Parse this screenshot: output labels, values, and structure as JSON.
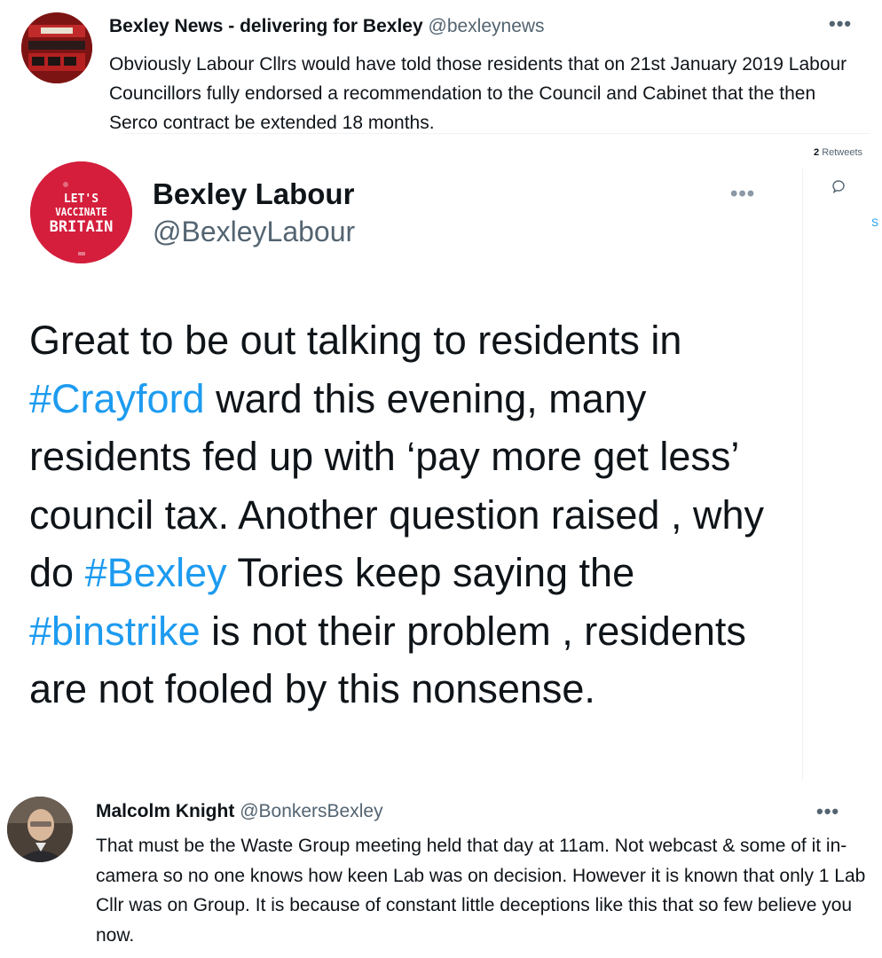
{
  "tweet1": {
    "name": "Bexley News - delivering for Bexley",
    "handle": "@bexleynews",
    "more": "•••",
    "text": "Obviously Labour Cllrs would have told those residents that on 21st January 2019 Labour Councillors fully endorsed a recommendation to the Council and Cabinet that the then Serco contract be extended 18 months."
  },
  "side": {
    "retweet_count": "2",
    "retweet_label": "Retweets",
    "reply_icon": "reply-bubble-icon",
    "letter": "S"
  },
  "tweet2": {
    "avatar_text": [
      "LET'S",
      "VACCINATE",
      "BRITAIN"
    ],
    "name": "Bexley Labour",
    "handle": "@BexleyLabour",
    "more": "•••",
    "text_parts": [
      "Great to be out talking to residents in ",
      "#Crayford",
      " ward this evening, many residents fed up with ‘pay more get less’ council tax. Another question raised , why do ",
      "#Bexley",
      " Tories keep saying the ",
      "#binstrike",
      " is not their problem , residents are not fooled by this nonsense."
    ]
  },
  "tweet3": {
    "name": "Malcolm Knight",
    "handle": "@BonkersBexley",
    "more": "•••",
    "text": "That must be the Waste Group meeting held that day at 11am. Not webcast & some of it in-camera so no one knows how keen Lab was on decision. However it is known that only 1 Lab Cllr was on Group. It is because of constant little deceptions like this that so few believe you now."
  },
  "colors": {
    "text": "#0f1419",
    "secondary": "#536471",
    "link": "#1d9bf0",
    "labour_red": "#d41e3c"
  }
}
